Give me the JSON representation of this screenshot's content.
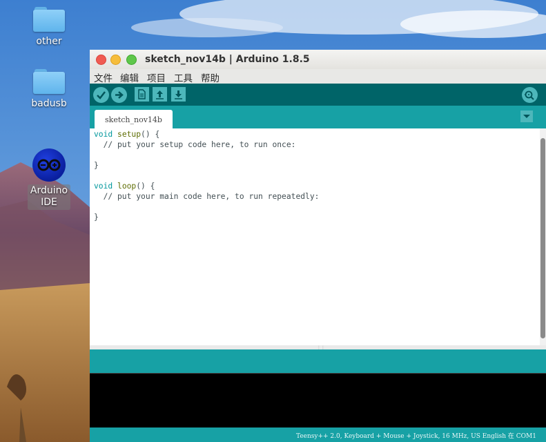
{
  "desktop": {
    "icons": [
      {
        "label": "other",
        "icon": "folder-icon"
      },
      {
        "label": "badusb",
        "icon": "folder-icon"
      },
      {
        "label": "Arduino\nIDE",
        "icon": "arduino-logo-icon"
      }
    ]
  },
  "window": {
    "title": "sketch_nov14b | Arduino 1.8.5",
    "menu": [
      "文件",
      "编辑",
      "项目",
      "工具",
      "帮助"
    ],
    "toolbar": [
      "verify-icon",
      "upload-icon",
      "new-icon",
      "open-icon",
      "save-icon",
      "serial-monitor-icon"
    ],
    "tab_label": "sketch_nov14b",
    "code": {
      "line1_kw": "void",
      "line1_fn": "setup",
      "line1_rest": "() {",
      "line2": "  // put your setup code here, to run once:",
      "line4": "}",
      "line6_kw": "void",
      "line6_fn": "loop",
      "line6_rest": "() {",
      "line7": "  // put your main code here, to run repeatedly:",
      "line9": "}"
    },
    "status": "Teensy++ 2.0, Keyboard + Mouse + Joystick, 16 MHz, US English 在 COM1"
  },
  "colors": {
    "toolbar": "#006468",
    "tabbar": "#17a1a5",
    "button": "#4db7bb",
    "keyword": "#00979c",
    "function": "#5e6d03"
  }
}
